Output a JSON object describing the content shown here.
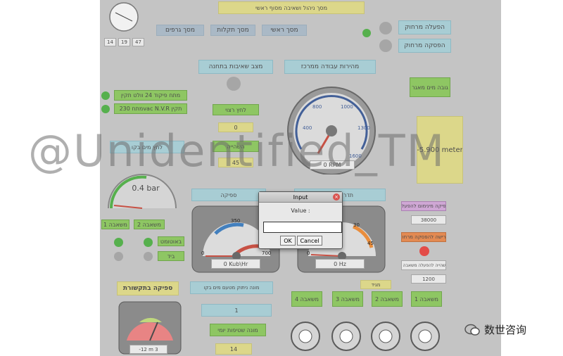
{
  "window": {
    "header_title": "מסך ניהול ושאיבה מסוף ראשי",
    "clock_readouts": [
      "14",
      "19",
      "47"
    ]
  },
  "nav": {
    "main_screen": "מסך ראשי",
    "faults_screen": "מסך תקלות",
    "graphs_screen": "מסך גרפים"
  },
  "remote": {
    "start": "הפעלה מרחוק",
    "stop": "הפסקה מרחוק"
  },
  "top_row": {
    "pumps_status": "מצב שאיבות בתחנה",
    "work_speed": "מהירות עבודה ממרכז"
  },
  "left_status": {
    "status_24v": "מתח פיקוד 24 וולט תקין",
    "status_230v": "מתח 230vac N.V.R תקין"
  },
  "tank": {
    "label": "גובה מים מאגר",
    "value": "-5.900 meter"
  },
  "pressure": {
    "system_label": "לחץ רצוי",
    "system_value": "0",
    "delay_label": "השהייה",
    "delay_value": "45",
    "line_label": "לחץ מים בקו",
    "gauge_value": "0.4 bar"
  },
  "pump_gauge": {
    "readout": "0 RPM",
    "ticks": [
      "400",
      "800",
      "1000",
      "1300",
      "1600"
    ]
  },
  "flow": {
    "label": "ספיקה",
    "readout": "0 Kub\\Hr",
    "ticks": [
      "0",
      "350",
      "700"
    ]
  },
  "freq": {
    "label": "תדר עבודה",
    "readout": "0 Hz",
    "ticks": [
      "0",
      "15",
      "30",
      "45"
    ]
  },
  "pump_select": {
    "pump1": "משאבה 1",
    "pump2": "משאבה 2",
    "pump3": "משאבה 3",
    "pump4": "משאבה 4"
  },
  "mode": {
    "auto": "באוטומט",
    "manual": "ביד"
  },
  "right_panel": {
    "min_flow_label": "ספיקה מינימום להפעלה",
    "min_flow_value": "38000",
    "remote_request": "דרישה להפסקה מרחוק",
    "delay_start_label": "השהייה להפעלה משאבה 1",
    "delay_start_value": "1200"
  },
  "bottom": {
    "comm_flow": "ספיקה בתקשורת",
    "tank_fill": "מונה ניתוק מטעם מים בקו",
    "tank_fill_value": "1",
    "daily_counter": "מונה שטיפות יומי",
    "daily_value": "14",
    "pump_time": "מגיד",
    "level_readout": "-12 m 3"
  },
  "dialog": {
    "title": "Input",
    "prompt": "Value :",
    "ok": "OK",
    "cancel": "Cancel"
  },
  "watermark": "@Unidentified_TM",
  "brand": "数世咨询"
}
